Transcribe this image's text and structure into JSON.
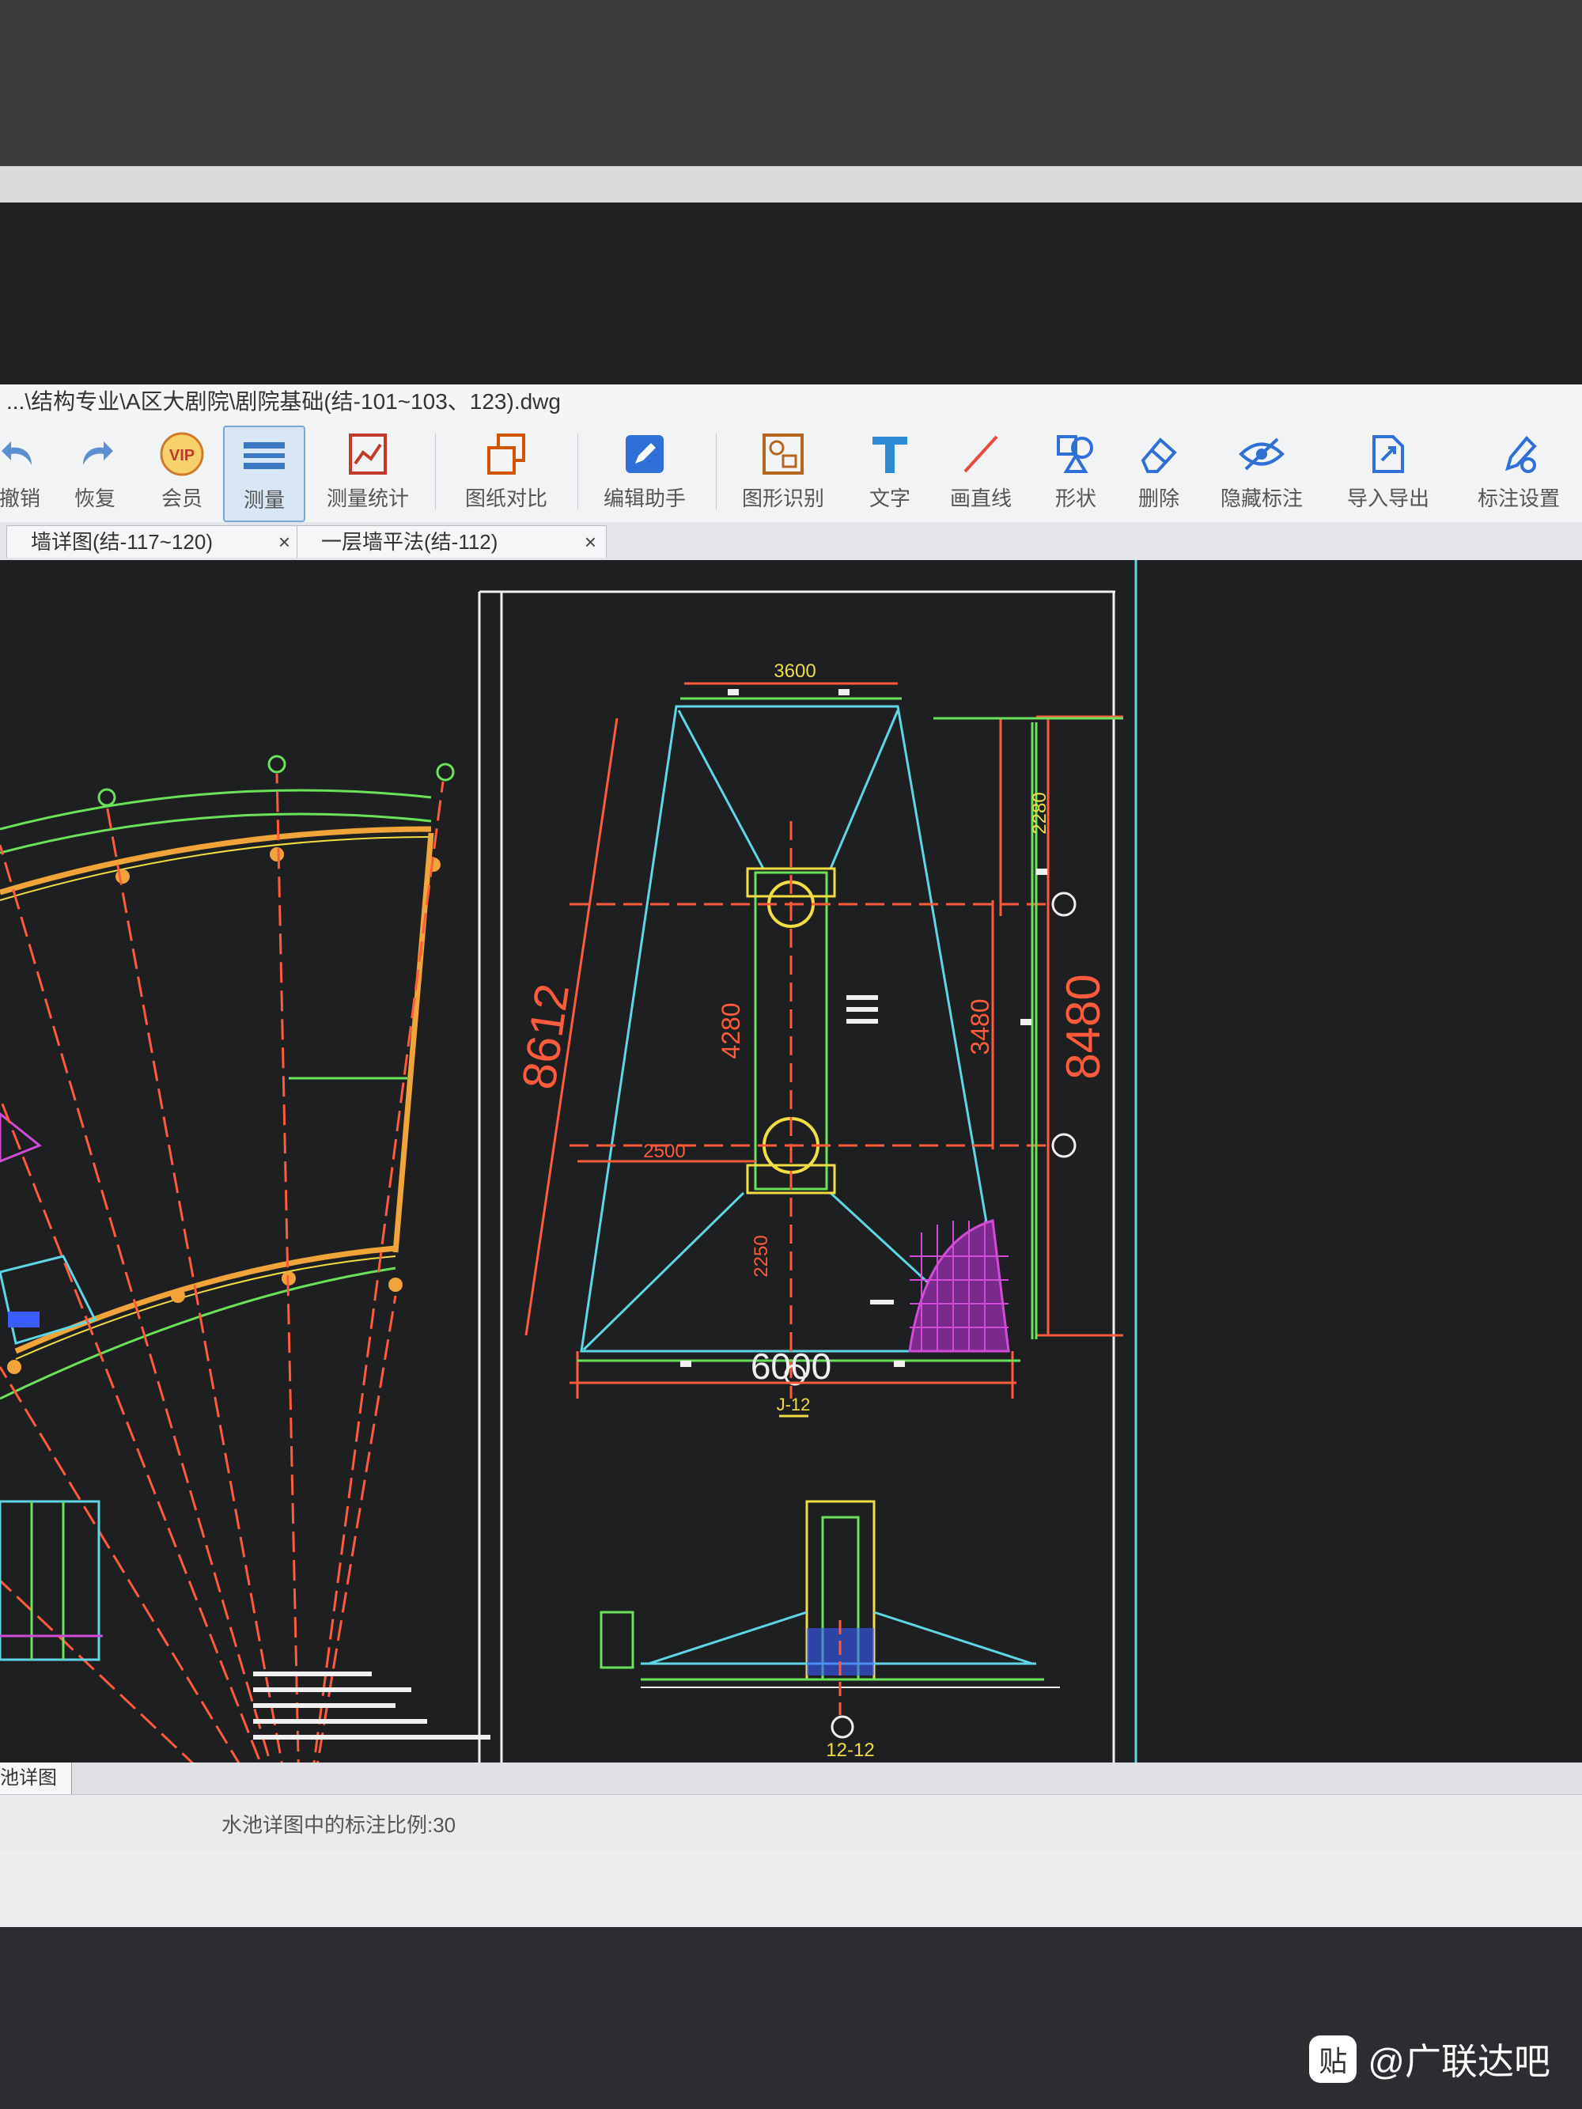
{
  "window": {
    "title": "...\\结构专业\\A区大剧院\\剧院基础(结-101~103、123).dwg"
  },
  "toolbar": {
    "items": [
      {
        "label": "撤销",
        "icon": "undo-icon"
      },
      {
        "label": "恢复",
        "icon": "redo-icon"
      },
      {
        "label": "会员",
        "icon": "vip-icon",
        "badge": "VIP"
      },
      {
        "label": "测量",
        "icon": "measure-icon",
        "active": true
      },
      {
        "label": "测量统计",
        "icon": "measure-stats-icon"
      },
      {
        "label": "图纸对比",
        "icon": "compare-icon"
      },
      {
        "label": "编辑助手",
        "icon": "edit-assistant-icon"
      },
      {
        "label": "图形识别",
        "icon": "shape-recognition-icon"
      },
      {
        "label": "文字",
        "icon": "text-icon"
      },
      {
        "label": "画直线",
        "icon": "line-icon"
      },
      {
        "label": "形状",
        "icon": "shape-icon"
      },
      {
        "label": "删除",
        "icon": "eraser-icon"
      },
      {
        "label": "隐藏标注",
        "icon": "hide-annotation-icon"
      },
      {
        "label": "导入导出",
        "icon": "import-export-icon"
      },
      {
        "label": "标注设置",
        "icon": "annotation-settings-icon"
      }
    ]
  },
  "tabs": [
    {
      "label": "墙详图(结-117~120)",
      "close": "×"
    },
    {
      "label": "一层墙平法(结-112)",
      "close": "×"
    }
  ],
  "drawing": {
    "dims": {
      "top": "3600",
      "left_slant": "8612",
      "right_total": "8480",
      "right_upper": "2280",
      "right_mid": "3480",
      "center_vertical": "4280",
      "left_horizontal": "2500",
      "lower_vertical": "2250",
      "bottom": "6000"
    },
    "section_labels": [
      "J-12",
      "12-12"
    ]
  },
  "layout_tab": {
    "label": "池详图"
  },
  "status": {
    "message": "水池详图中的标注比例:30"
  },
  "watermark": {
    "badge": "贴",
    "text": "@广联达吧"
  },
  "colors": {
    "canvas_bg": "#1d1f21",
    "red": "#ff5a3c",
    "cyan": "#5fd6e6",
    "green": "#6be25a",
    "yellow": "#f2dd44",
    "white": "#f0f0f0",
    "magenta": "#d24bd6",
    "orange": "#f0a43a"
  }
}
